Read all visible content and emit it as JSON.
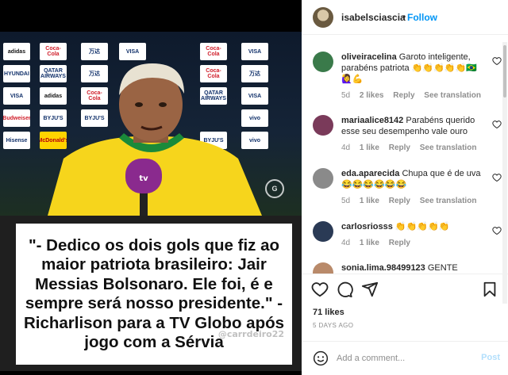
{
  "post": {
    "author": "isabelsciascia",
    "separator": "•",
    "follow_label": "Follow",
    "more_label": "•••",
    "media": {
      "tv_logo": "G",
      "watermark": "@carrdeiro22",
      "quote": "\"- Dedico os dois gols que fiz ao maior patriota brasileiro: Jair Messias Bolsonaro. Ele foi, é e sempre será nosso presidente.\" - Richarlison para a TV Globo após jogo com a Sérvia",
      "sponsor_boards": [
        "VISA",
        "Coca-Cola",
        "万达",
        "QATAR AIRWAYS",
        "adidas",
        "HYUNDAI",
        "BYJU'S",
        "vivo",
        "Hisense",
        "McDonald's",
        "Budweiser"
      ]
    }
  },
  "comments": [
    {
      "username": "oliveiracelina",
      "text": "Garoto inteligente, parabéns patriota 👏👏👏👏👏🇧🇷🙋‍♀️💪",
      "time": "5d",
      "likes": "2 likes",
      "reply_label": "Reply",
      "translation_label": "See translation",
      "avatar_color": "#3a7a4a"
    },
    {
      "username": "mariaalice8142",
      "text": "Parabéns querido esse seu desempenho vale ouro",
      "time": "4d",
      "likes": "1 like",
      "reply_label": "Reply",
      "translation_label": "See translation",
      "avatar_color": "#7a3a5a"
    },
    {
      "username": "eda.aparecida",
      "text": "Chupa que é de uva 😂😂😂😂😂😂",
      "time": "5d",
      "likes": "1 like",
      "reply_label": "Reply",
      "translation_label": "See translation",
      "avatar_color": "#8a8a8a"
    },
    {
      "username": "carlosriosss",
      "text": "👏👏👏👏👏",
      "time": "4d",
      "likes": "1 like",
      "reply_label": "Reply",
      "translation_label": "",
      "avatar_color": "#2a3a55"
    },
    {
      "username": "sonia.lima.98499123",
      "text": "GENTE",
      "time": "",
      "likes": "",
      "reply_label": "",
      "translation_label": "",
      "avatar_color": "#b98a6a"
    }
  ],
  "stats": {
    "likes": "71 likes",
    "time_ago": "5 DAYS AGO"
  },
  "composer": {
    "placeholder": "Add a comment...",
    "post_label": "Post"
  },
  "icons": {
    "like": "heart-icon",
    "comment": "comment-icon",
    "share": "share-icon",
    "save": "bookmark-icon",
    "emoji": "smiley-icon"
  },
  "colors": {
    "link_blue": "#0095f6",
    "post_disabled": "#b2dffc",
    "meta_gray": "#8e8e8e",
    "jersey_yellow": "#f6d51c",
    "mic_purple": "#8a2a8e"
  }
}
